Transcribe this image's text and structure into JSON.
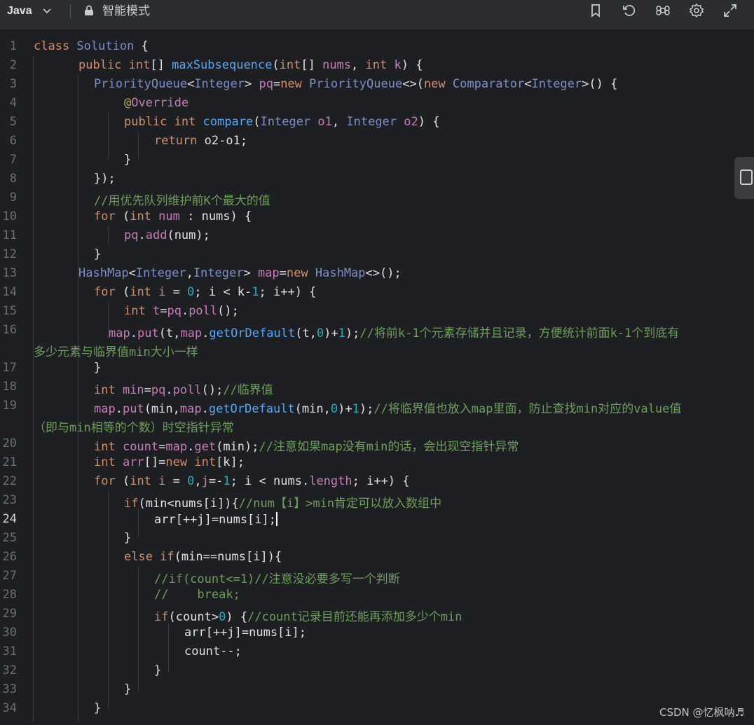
{
  "toolbar": {
    "language": "Java",
    "mode_label": "智能模式",
    "icons": [
      "chevron-down-icon",
      "lock-icon",
      "bookmark-icon",
      "reset-icon",
      "command-icon",
      "settings-icon",
      "expand-icon"
    ]
  },
  "editor": {
    "lines": [
      {
        "n": "1"
      },
      {
        "n": "2"
      },
      {
        "n": "3"
      },
      {
        "n": "4"
      },
      {
        "n": "5"
      },
      {
        "n": "6"
      },
      {
        "n": "7"
      },
      {
        "n": "8"
      },
      {
        "n": "9"
      },
      {
        "n": "10"
      },
      {
        "n": "11"
      },
      {
        "n": "12"
      },
      {
        "n": "13"
      },
      {
        "n": "14"
      },
      {
        "n": "15"
      },
      {
        "n": "16"
      },
      {
        "n": "17"
      },
      {
        "n": "18"
      },
      {
        "n": "19"
      },
      {
        "n": "20"
      },
      {
        "n": "21"
      },
      {
        "n": "22"
      },
      {
        "n": "23"
      },
      {
        "n": "24"
      },
      {
        "n": "25"
      },
      {
        "n": "26"
      },
      {
        "n": "27"
      },
      {
        "n": "28"
      },
      {
        "n": "29"
      },
      {
        "n": "30"
      },
      {
        "n": "31"
      },
      {
        "n": "32"
      },
      {
        "n": "33"
      },
      {
        "n": "34"
      }
    ],
    "active_line": "24",
    "code": [
      [
        [
          "kw",
          "class "
        ],
        [
          "cls",
          "Solution "
        ],
        [
          "plain",
          "{"
        ]
      ],
      [
        [
          "kw",
          "public "
        ],
        [
          "kw",
          "int"
        ],
        [
          "plain",
          "[] "
        ],
        [
          "fn",
          "maxSubsequence"
        ],
        [
          "plain",
          "("
        ],
        [
          "kw",
          "int"
        ],
        [
          "plain",
          "[] "
        ],
        [
          "param",
          "nums"
        ],
        [
          "plain",
          ", "
        ],
        [
          "kw",
          "int "
        ],
        [
          "param",
          "k"
        ],
        [
          "plain",
          ") {"
        ]
      ],
      [
        [
          "cls",
          "PriorityQueue"
        ],
        [
          "plain",
          "<"
        ],
        [
          "cls",
          "Integer"
        ],
        [
          "plain",
          "> "
        ],
        [
          "var",
          "pq"
        ],
        [
          "plain",
          "="
        ],
        [
          "kw",
          "new "
        ],
        [
          "cls",
          "PriorityQueue"
        ],
        [
          "plain",
          "<>("
        ],
        [
          "kw",
          "new "
        ],
        [
          "cls",
          "Comparator"
        ],
        [
          "plain",
          "<"
        ],
        [
          "cls",
          "Integer"
        ],
        [
          "plain",
          ">() {"
        ]
      ],
      [
        [
          "ann",
          "@"
        ],
        [
          "var",
          "Override"
        ]
      ],
      [
        [
          "kw",
          "public "
        ],
        [
          "kw",
          "int "
        ],
        [
          "fn",
          "compare"
        ],
        [
          "plain",
          "("
        ],
        [
          "cls",
          "Integer "
        ],
        [
          "param",
          "o1"
        ],
        [
          "plain",
          ", "
        ],
        [
          "cls",
          "Integer "
        ],
        [
          "param",
          "o2"
        ],
        [
          "plain",
          ") {"
        ]
      ],
      [
        [
          "kw",
          "return "
        ],
        [
          "plain",
          "o2-o1;"
        ]
      ],
      [
        [
          "plain",
          "}"
        ]
      ],
      [
        [
          "plain",
          "});"
        ]
      ],
      [
        [
          "cm",
          "//用优先队列维护前K个最大的值"
        ]
      ],
      [
        [
          "kw",
          "for "
        ],
        [
          "plain",
          "("
        ],
        [
          "kw",
          "int "
        ],
        [
          "param",
          "num "
        ],
        [
          "plain",
          ": nums) {"
        ]
      ],
      [
        [
          "var",
          "pq"
        ],
        [
          "plain",
          "."
        ],
        [
          "var",
          "add"
        ],
        [
          "plain",
          "(num);"
        ]
      ],
      [
        [
          "plain",
          "}"
        ]
      ],
      [
        [
          "cls",
          "HashMap"
        ],
        [
          "plain",
          "<"
        ],
        [
          "cls",
          "Integer"
        ],
        [
          "plain",
          ","
        ],
        [
          "cls",
          "Integer"
        ],
        [
          "plain",
          "> "
        ],
        [
          "var",
          "map"
        ],
        [
          "plain",
          "="
        ],
        [
          "kw",
          "new "
        ],
        [
          "cls",
          "HashMap"
        ],
        [
          "plain",
          "<>();"
        ]
      ],
      [
        [
          "kw",
          "for "
        ],
        [
          "plain",
          "("
        ],
        [
          "kw",
          "int "
        ],
        [
          "param",
          "i "
        ],
        [
          "plain",
          "= "
        ],
        [
          "num",
          "0"
        ],
        [
          "plain",
          "; i < k-"
        ],
        [
          "num",
          "1"
        ],
        [
          "plain",
          "; i++) {"
        ]
      ],
      [
        [
          "kw",
          "int "
        ],
        [
          "param",
          "t"
        ],
        [
          "plain",
          "="
        ],
        [
          "var",
          "pq"
        ],
        [
          "plain",
          "."
        ],
        [
          "var",
          "poll"
        ],
        [
          "plain",
          "();"
        ]
      ],
      [
        [
          "var",
          "map"
        ],
        [
          "plain",
          "."
        ],
        [
          "var",
          "put"
        ],
        [
          "plain",
          "(t,"
        ],
        [
          "var",
          "map"
        ],
        [
          "plain",
          "."
        ],
        [
          "fn",
          "getOrDefault"
        ],
        [
          "plain",
          "(t,"
        ],
        [
          "num",
          "0"
        ],
        [
          "plain",
          ")+"
        ],
        [
          "num",
          "1"
        ],
        [
          "plain",
          ");"
        ],
        [
          "cm",
          "//将前k-1个元素存储并且记录，方便统计前面k-1个到底有"
        ]
      ],
      [
        [
          "plain",
          "}"
        ]
      ],
      [
        [
          "kw",
          "int "
        ],
        [
          "param",
          "min"
        ],
        [
          "plain",
          "="
        ],
        [
          "var",
          "pq"
        ],
        [
          "plain",
          "."
        ],
        [
          "var",
          "poll"
        ],
        [
          "plain",
          "();"
        ],
        [
          "cm",
          "//临界值"
        ]
      ],
      [
        [
          "var",
          "map"
        ],
        [
          "plain",
          "."
        ],
        [
          "var",
          "put"
        ],
        [
          "plain",
          "(min,"
        ],
        [
          "var",
          "map"
        ],
        [
          "plain",
          "."
        ],
        [
          "fn",
          "getOrDefault"
        ],
        [
          "plain",
          "(min,"
        ],
        [
          "num",
          "0"
        ],
        [
          "plain",
          ")+"
        ],
        [
          "num",
          "1"
        ],
        [
          "plain",
          ");"
        ],
        [
          "cm",
          "//将临界值也放入map里面，防止查找min对应的value值"
        ]
      ],
      [
        [
          "kw",
          "int "
        ],
        [
          "param",
          "count"
        ],
        [
          "plain",
          "="
        ],
        [
          "var",
          "map"
        ],
        [
          "plain",
          "."
        ],
        [
          "var",
          "get"
        ],
        [
          "plain",
          "(min);"
        ],
        [
          "cm",
          "//注意如果map没有min的话，会出现空指针异常"
        ]
      ],
      [
        [
          "kw",
          "int "
        ],
        [
          "param",
          "arr"
        ],
        [
          "plain",
          "[]="
        ],
        [
          "kw",
          "new "
        ],
        [
          "kw",
          "int"
        ],
        [
          "plain",
          "[k];"
        ]
      ],
      [
        [
          "kw",
          "for "
        ],
        [
          "plain",
          "("
        ],
        [
          "kw",
          "int "
        ],
        [
          "param",
          "i "
        ],
        [
          "plain",
          "= "
        ],
        [
          "num",
          "0"
        ],
        [
          "plain",
          ","
        ],
        [
          "param",
          "j"
        ],
        [
          "plain",
          "=-"
        ],
        [
          "num",
          "1"
        ],
        [
          "plain",
          "; i < nums."
        ],
        [
          "var",
          "length"
        ],
        [
          "plain",
          "; i++) {"
        ]
      ],
      [
        [
          "kw",
          "if"
        ],
        [
          "plain",
          "(min<nums[i])"
        ],
        [
          "plain",
          "{"
        ],
        [
          "cm",
          "//num【i】>min肯定可以放入数组中"
        ]
      ],
      [
        [
          "plain",
          "arr[++j]=nums[i];"
        ]
      ],
      [
        [
          "plain",
          "}"
        ]
      ],
      [
        [
          "kw",
          "else if"
        ],
        [
          "plain",
          "(min==nums[i]){"
        ]
      ],
      [
        [
          "cm",
          "//if(count<=1)//注意没必要多写一个判断"
        ]
      ],
      [
        [
          "cm",
          "//    break;"
        ]
      ],
      [
        [
          "kw",
          "if"
        ],
        [
          "plain",
          "(count>"
        ],
        [
          "num",
          "0"
        ],
        [
          "plain",
          ") {"
        ],
        [
          "cm",
          "//count记录目前还能再添加多少个min"
        ]
      ],
      [
        [
          "plain",
          "arr[++j]=nums[i];"
        ]
      ],
      [
        [
          "plain",
          "count--;"
        ]
      ],
      [
        [
          "plain",
          "}"
        ]
      ],
      [
        [
          "plain",
          "}"
        ]
      ],
      [
        [
          "plain",
          "}"
        ]
      ]
    ],
    "wrap": {
      "16": "多少元素与临界值min大小一样",
      "19": "（即与min相等的个数）时空指针异常"
    }
  },
  "watermark": "CSDN @忆枫呐♬"
}
